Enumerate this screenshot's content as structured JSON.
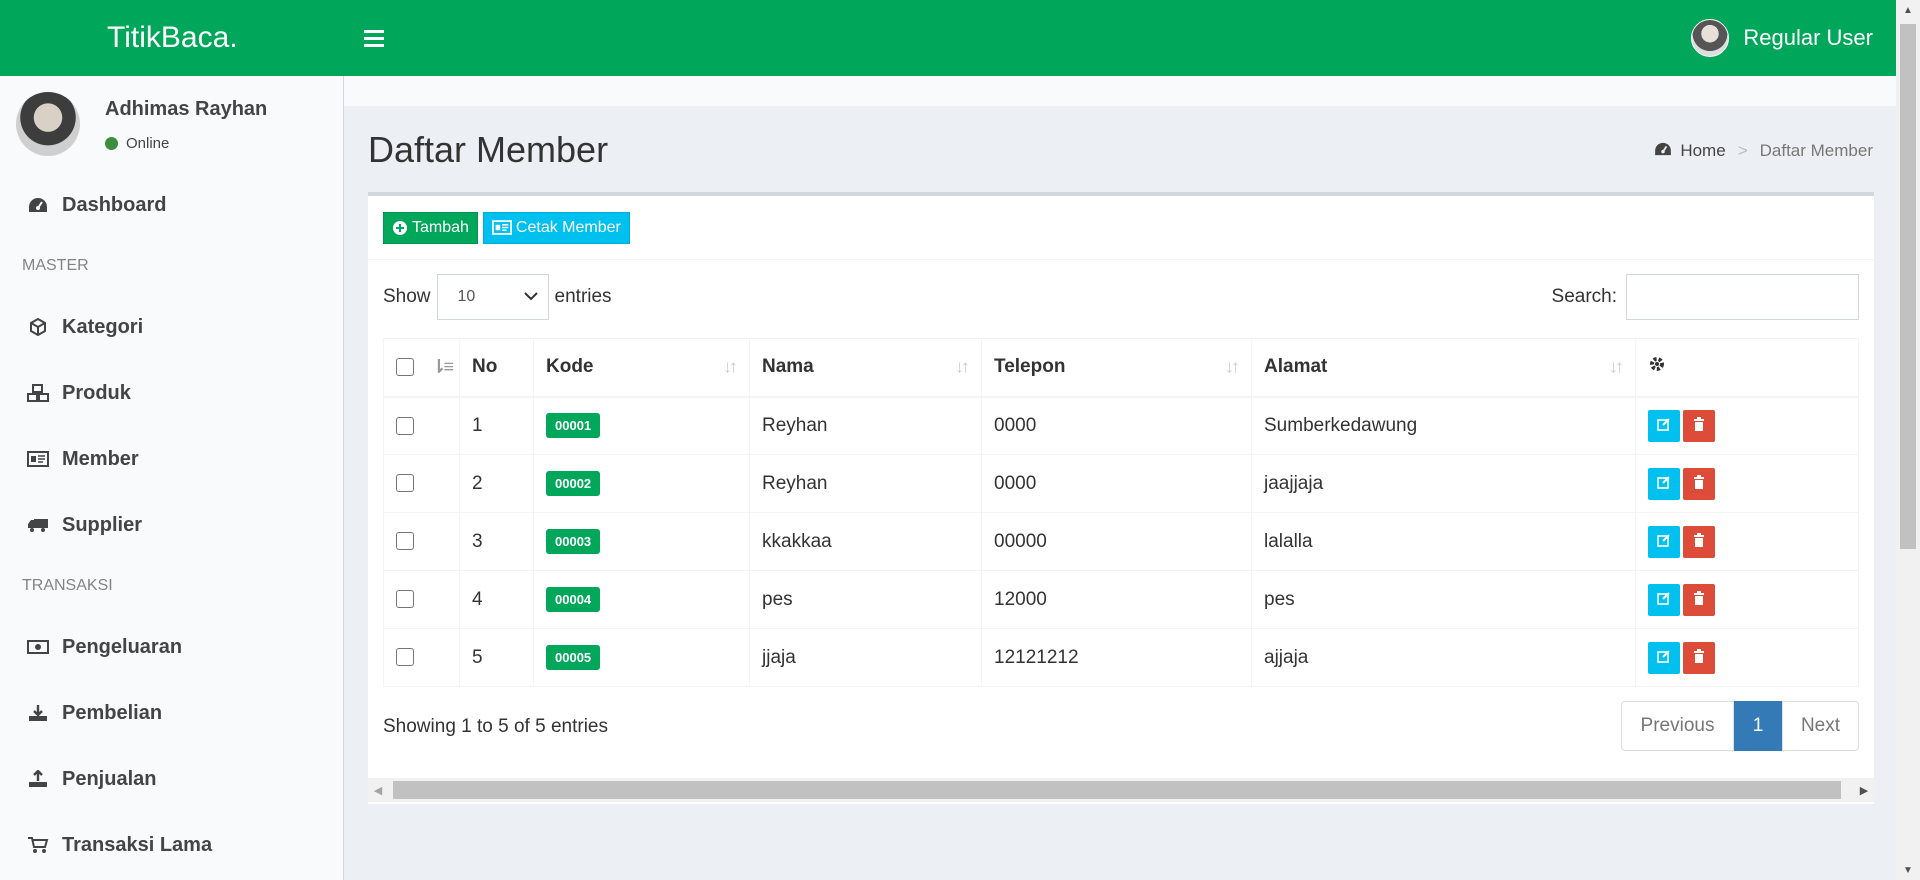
{
  "header": {
    "brand": "TitikBaca.",
    "user_name": "Regular User"
  },
  "sidebar": {
    "user": {
      "name": "Adhimas Rayhan",
      "status": "Online"
    },
    "dashboard": "Dashboard",
    "master_header": "MASTER",
    "master_items": [
      "Kategori",
      "Produk",
      "Member",
      "Supplier"
    ],
    "transaksi_header": "TRANSAKSI",
    "transaksi_items": [
      "Pengeluaran",
      "Pembelian",
      "Penjualan",
      "Transaksi Lama"
    ]
  },
  "page": {
    "title": "Daftar Member"
  },
  "breadcrumb": {
    "home": "Home",
    "current": "Daftar Member"
  },
  "toolbar": {
    "add_label": "Tambah",
    "print_label": "Cetak Member"
  },
  "datatable": {
    "show_label": "Show",
    "entries_label": "entries",
    "page_length": "10",
    "search_label": "Search:",
    "search_value": "",
    "columns": [
      "No",
      "Kode",
      "Nama",
      "Telepon",
      "Alamat"
    ],
    "rows": [
      {
        "no": "1",
        "kode": "00001",
        "nama": "Reyhan",
        "telepon": "0000",
        "alamat": "Sumberkedawung"
      },
      {
        "no": "2",
        "kode": "00002",
        "nama": "Reyhan",
        "telepon": "0000",
        "alamat": "jaajjaja"
      },
      {
        "no": "3",
        "kode": "00003",
        "nama": "kkakkaa",
        "telepon": "00000",
        "alamat": "lalalla"
      },
      {
        "no": "4",
        "kode": "00004",
        "nama": "pes",
        "telepon": "12000",
        "alamat": "pes"
      },
      {
        "no": "5",
        "kode": "00005",
        "nama": "jjaja",
        "telepon": "12121212",
        "alamat": "ajjaja"
      }
    ],
    "info": "Showing 1 to 5 of 5 entries",
    "pagination": {
      "previous": "Previous",
      "current_page": "1",
      "next": "Next"
    }
  },
  "colors": {
    "brand_green": "#00a65a",
    "info_blue": "#00c0ef",
    "danger_red": "#dd4b39",
    "page_active": "#337ab7"
  },
  "icons": {
    "dashboard": "tachometer-icon",
    "kategori": "cube-icon",
    "produk": "cubes-icon",
    "member": "id-card-icon",
    "supplier": "truck-icon",
    "pengeluaran": "money-icon",
    "pembelian": "download-icon",
    "penjualan": "upload-icon",
    "transaksi_lama": "cart-icon"
  }
}
